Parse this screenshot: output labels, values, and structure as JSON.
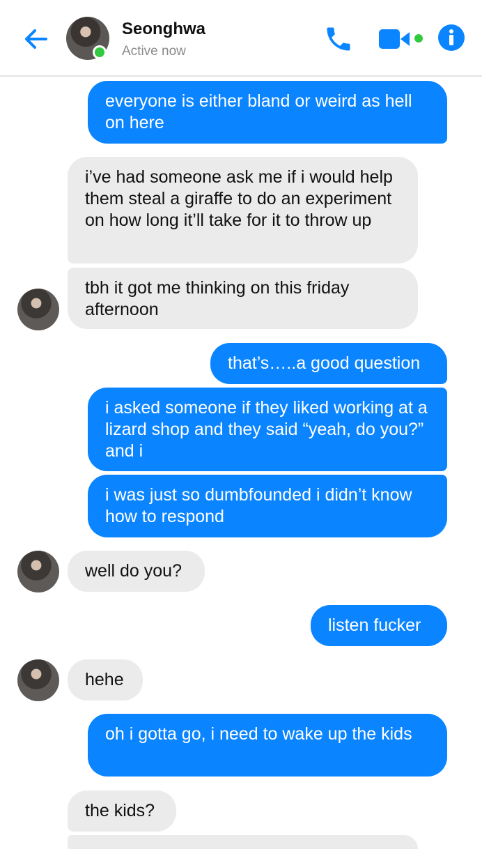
{
  "header": {
    "contact_name": "Seonghwa",
    "status": "Active now",
    "icons": [
      "back-arrow-icon",
      "phone-icon",
      "video-camera-icon",
      "info-icon"
    ],
    "accent_color": "#0a84ff",
    "online_color": "#31c93f"
  },
  "messages": [
    {
      "from": "me",
      "text": "everyone is either bland or weird as hell on here"
    },
    {
      "from": "them",
      "text": "i’ve had someone ask me if i would help them steal a giraffe to do an experiment on how long it’ll take for it to throw up"
    },
    {
      "from": "them",
      "text": "tbh it got me thinking on this friday afternoon"
    },
    {
      "from": "me",
      "text": "that’s…..a good question"
    },
    {
      "from": "me",
      "text": "i asked someone if they liked working at a lizard shop and they said “yeah, do you?” and i"
    },
    {
      "from": "me",
      "text": "i was just so dumbfounded i didn’t know how to respond"
    },
    {
      "from": "them",
      "text": "well do you?"
    },
    {
      "from": "me",
      "text": "listen fucker"
    },
    {
      "from": "them",
      "text": "hehe"
    },
    {
      "from": "me",
      "text": "oh i gotta go, i need to wake up the kids"
    },
    {
      "from": "them",
      "text": "the kids?"
    }
  ],
  "colors": {
    "outgoing_bubble": "#0a84ff",
    "incoming_bubble": "#ebebeb"
  }
}
